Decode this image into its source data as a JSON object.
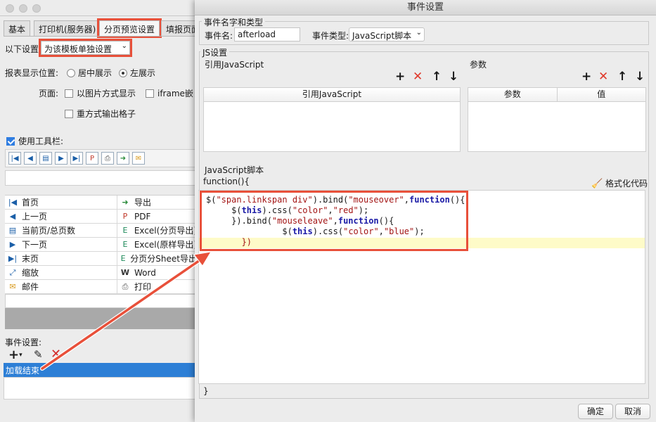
{
  "bg": {
    "tabs": [
      "基本",
      "打印机(服务器)",
      "分页预览设置",
      "填报页面"
    ],
    "below_label": "以下设置:",
    "below_value": "为该模板单独设置",
    "report_pos_label": "报表显示位置:",
    "pos_center": "居中展示",
    "pos_left": "左展示",
    "page_label": "页面:",
    "img_mode": "以图片方式显示",
    "iframe": "iframe嵌",
    "re_output": "重方式输出格子",
    "use_toolbar": "使用工具栏:",
    "grid": [
      [
        "首页",
        "导出"
      ],
      [
        "上一页",
        "PDF"
      ],
      [
        "当前页/总页数",
        "Excel(分页导出)"
      ],
      [
        "下一页",
        "Excel(原样导出)"
      ],
      [
        "末页",
        "分页分Sheet导出"
      ],
      [
        "缩放",
        "Word"
      ],
      [
        "邮件",
        "打印"
      ]
    ],
    "event_label": "事件设置:",
    "event_item": "加载结束"
  },
  "dialog": {
    "title": "事件设置",
    "name_type_legend": "事件名字和类型",
    "event_name_label": "事件名:",
    "event_name_value": "afterload",
    "event_type_label": "事件类型:",
    "event_type_value": "JavaScript脚本",
    "js_settings_legend": "JS设置",
    "ref_js_label": "引用JavaScript",
    "params_label": "参数",
    "ref_js_header": "引用JavaScript",
    "param_header": "参数",
    "value_header": "值",
    "script_legend": "JavaScript脚本",
    "func_open": "function(){",
    "format_code": "格式化代码",
    "func_close": "}",
    "ok": "确定",
    "cancel": "取消"
  }
}
